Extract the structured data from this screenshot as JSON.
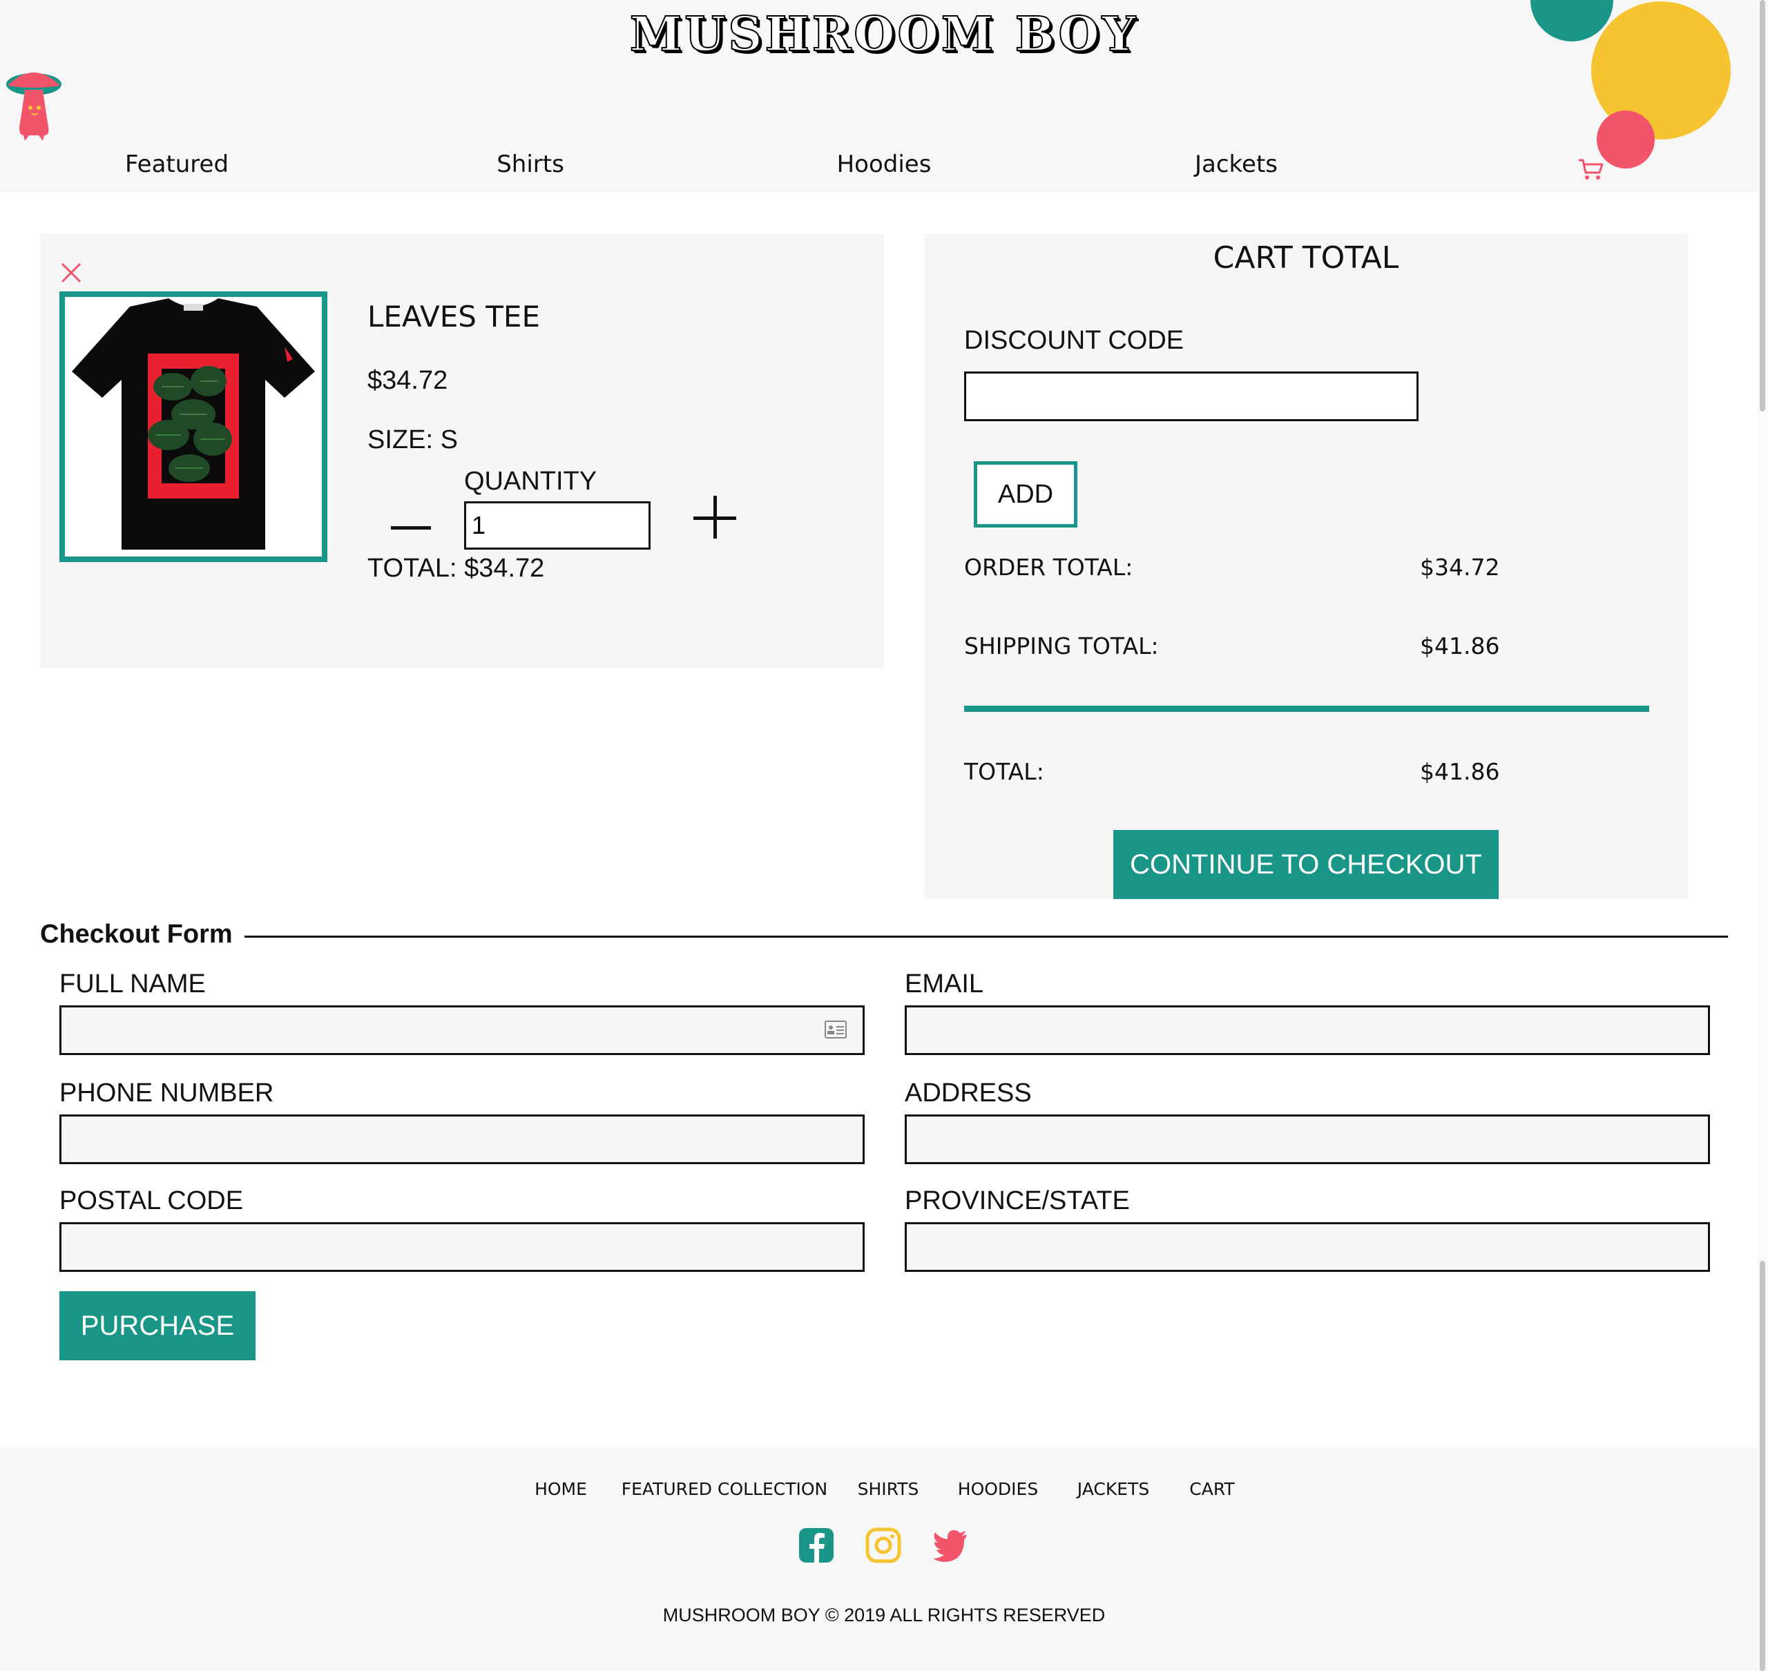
{
  "brand": {
    "name": "MUSHROOM BOY"
  },
  "nav": {
    "items": [
      "Featured",
      "Shirts",
      "Hoodies",
      "Jackets"
    ]
  },
  "cart_item": {
    "name": "LEAVES TEE",
    "price": "$34.72",
    "size_text": "SIZE: S",
    "quantity_label": "QUANTITY",
    "quantity_value": "1",
    "total_text": "TOTAL: $34.72"
  },
  "cart_total": {
    "title": "CART TOTAL",
    "discount_label": "DISCOUNT CODE",
    "add_label": "ADD",
    "order_total_label": "ORDER TOTAL:",
    "order_total_value": "$34.72",
    "shipping_total_label": "SHIPPING TOTAL:",
    "shipping_total_value": "$41.86",
    "total_label": "TOTAL:",
    "total_value": "$41.86",
    "checkout_label": "CONTINUE TO CHECKOUT"
  },
  "checkout_form": {
    "legend": "Checkout Form",
    "full_name_label": "FULL NAME",
    "email_label": "EMAIL",
    "phone_label": "PHONE NUMBER",
    "address_label": "ADDRESS",
    "postal_label": "POSTAL CODE",
    "province_label": "PROVINCE/STATE",
    "purchase_label": "PURCHASE"
  },
  "footer": {
    "links": [
      "HOME",
      "FEATURED COLLECTION",
      "SHIRTS",
      "HOODIES",
      "JACKETS",
      "CART"
    ],
    "social": [
      "facebook-icon",
      "instagram-icon",
      "twitter-icon"
    ],
    "copyright": "MUSHROOM BOY © 2019 ALL RIGHTS RESERVED"
  },
  "colors": {
    "teal": "#1a9688",
    "yellow": "#f6c431",
    "pink": "#f2546a"
  }
}
